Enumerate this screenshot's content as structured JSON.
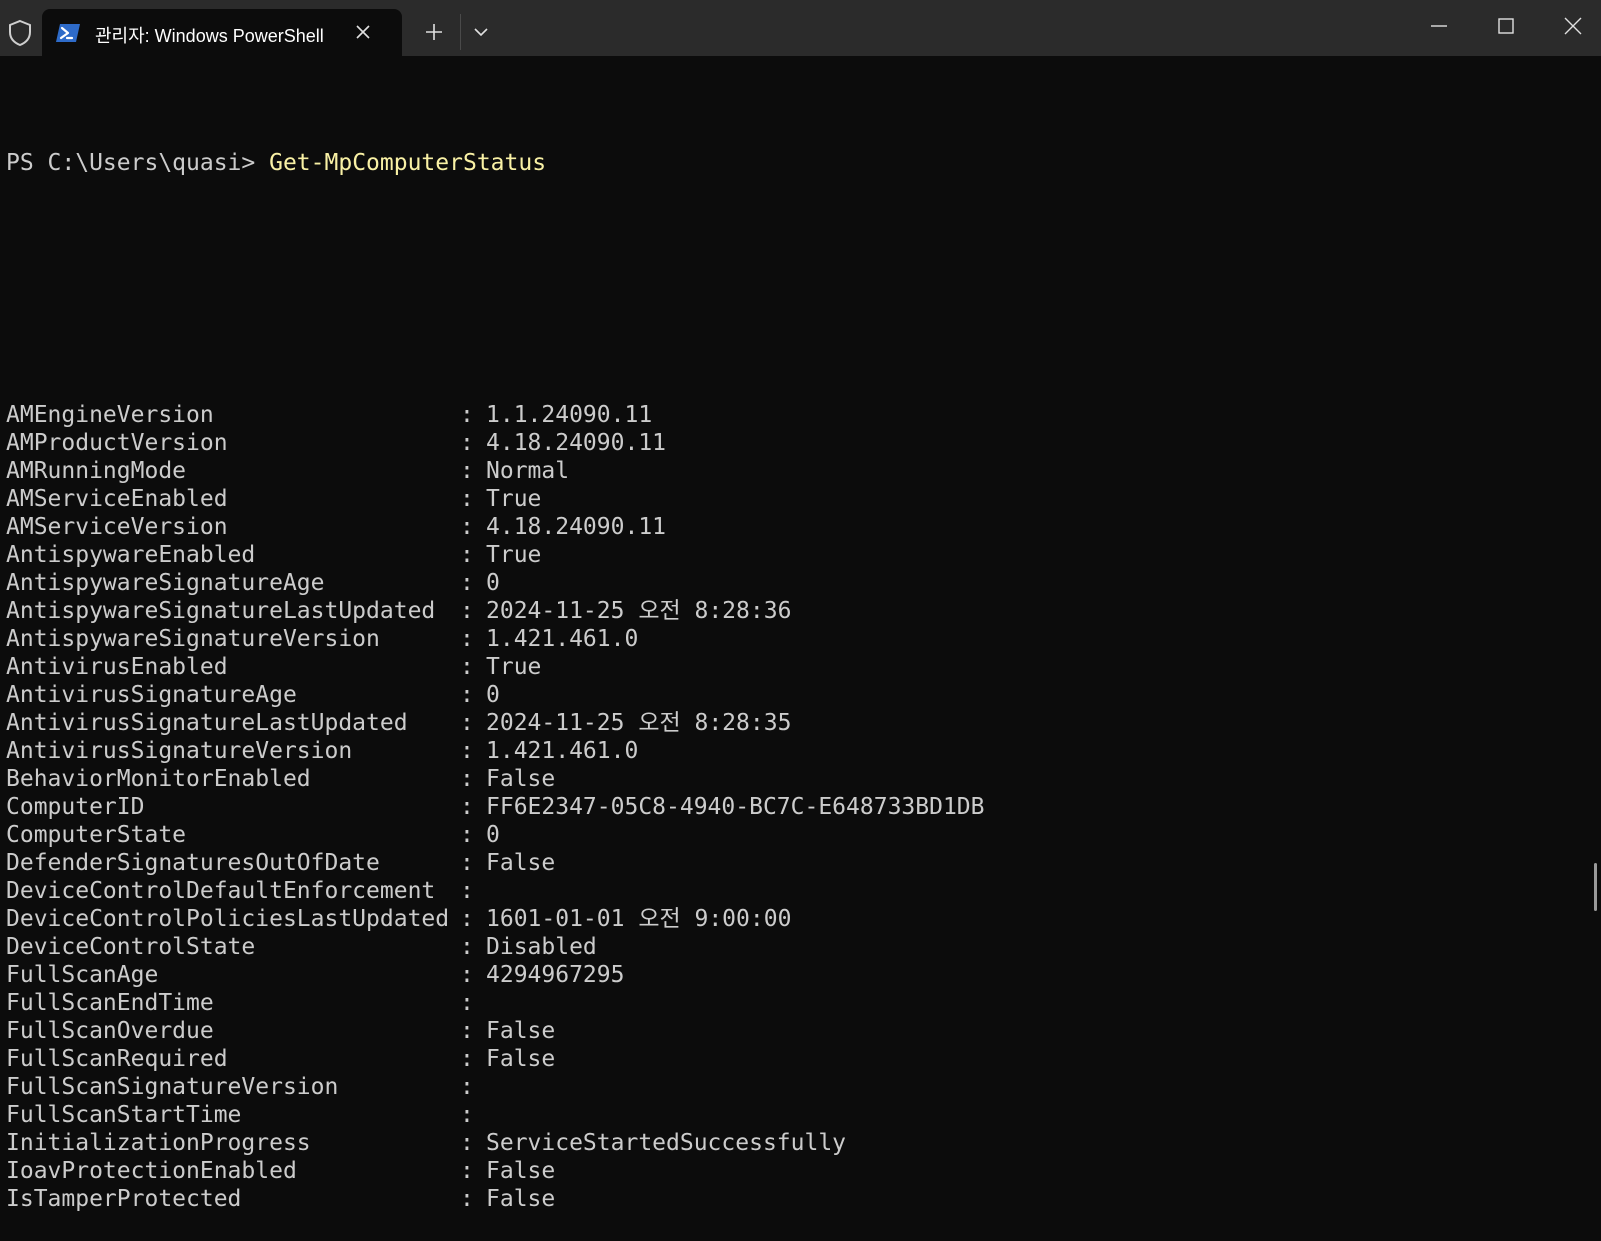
{
  "window": {
    "tab_title": "관리자: Windows PowerShell"
  },
  "console": {
    "prompt": "PS C:\\Users\\quasi> ",
    "command": "Get-MpComputerStatus",
    "rows": [
      {
        "key": "AMEngineVersion",
        "value": "1.1.24090.11"
      },
      {
        "key": "AMProductVersion",
        "value": "4.18.24090.11"
      },
      {
        "key": "AMRunningMode",
        "value": "Normal"
      },
      {
        "key": "AMServiceEnabled",
        "value": "True"
      },
      {
        "key": "AMServiceVersion",
        "value": "4.18.24090.11"
      },
      {
        "key": "AntispywareEnabled",
        "value": "True"
      },
      {
        "key": "AntispywareSignatureAge",
        "value": "0"
      },
      {
        "key": "AntispywareSignatureLastUpdated",
        "value": "2024-11-25 오전 8:28:36"
      },
      {
        "key": "AntispywareSignatureVersion",
        "value": "1.421.461.0"
      },
      {
        "key": "AntivirusEnabled",
        "value": "True"
      },
      {
        "key": "AntivirusSignatureAge",
        "value": "0"
      },
      {
        "key": "AntivirusSignatureLastUpdated",
        "value": "2024-11-25 오전 8:28:35"
      },
      {
        "key": "AntivirusSignatureVersion",
        "value": "1.421.461.0"
      },
      {
        "key": "BehaviorMonitorEnabled",
        "value": "False"
      },
      {
        "key": "ComputerID",
        "value": "FF6E2347-05C8-4940-BC7C-E648733BD1DB"
      },
      {
        "key": "ComputerState",
        "value": "0"
      },
      {
        "key": "DefenderSignaturesOutOfDate",
        "value": "False"
      },
      {
        "key": "DeviceControlDefaultEnforcement",
        "value": ""
      },
      {
        "key": "DeviceControlPoliciesLastUpdated",
        "value": "1601-01-01 오전 9:00:00"
      },
      {
        "key": "DeviceControlState",
        "value": "Disabled"
      },
      {
        "key": "FullScanAge",
        "value": "4294967295"
      },
      {
        "key": "FullScanEndTime",
        "value": ""
      },
      {
        "key": "FullScanOverdue",
        "value": "False"
      },
      {
        "key": "FullScanRequired",
        "value": "False"
      },
      {
        "key": "FullScanSignatureVersion",
        "value": ""
      },
      {
        "key": "FullScanStartTime",
        "value": ""
      },
      {
        "key": "InitializationProgress",
        "value": "ServiceStartedSuccessfully"
      },
      {
        "key": "IoavProtectionEnabled",
        "value": "False"
      },
      {
        "key": "IsTamperProtected",
        "value": "False"
      }
    ]
  },
  "colors": {
    "background": "#0c0c0c",
    "titlebar": "#2b2b2b",
    "text": "#cccccc",
    "command": "#f9f1a5"
  }
}
